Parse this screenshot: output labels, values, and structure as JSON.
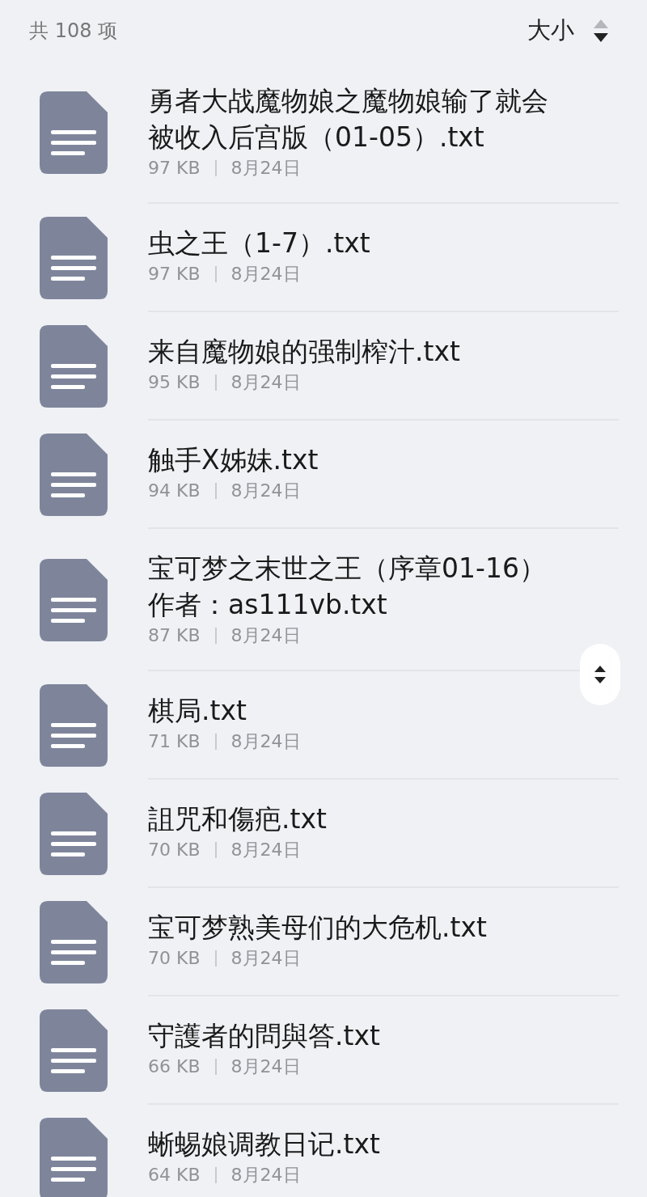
{
  "header": {
    "count": "共 108 项",
    "sort_label": "大小",
    "descending": true
  },
  "files": [
    {
      "name": "勇者大战魔物娘之魔物娘输了就会被收入后宫版（01-05）.txt",
      "size": "97 KB",
      "date": "8月24日"
    },
    {
      "name": "虫之王（1-7）.txt",
      "size": "97 KB",
      "date": "8月24日"
    },
    {
      "name": "来自魔物娘的强制榨汁.txt",
      "size": "95 KB",
      "date": "8月24日"
    },
    {
      "name": "触手X姊妹.txt",
      "size": "94 KB",
      "date": "8月24日"
    },
    {
      "name": "宝可梦之末世之王（序章01-16）作者：as111vb.txt",
      "size": "87 KB",
      "date": "8月24日"
    },
    {
      "name": "棋局.txt",
      "size": "71 KB",
      "date": "8月24日"
    },
    {
      "name": "詛咒和傷疤.txt",
      "size": "70 KB",
      "date": "8月24日"
    },
    {
      "name": "宝可梦熟美母们的大危机.txt",
      "size": "70 KB",
      "date": "8月24日"
    },
    {
      "name": "守護者的問與答.txt",
      "size": "66 KB",
      "date": "8月24日"
    },
    {
      "name": "蜥蜴娘调教日记.txt",
      "size": "64 KB",
      "date": "8月24日"
    }
  ]
}
